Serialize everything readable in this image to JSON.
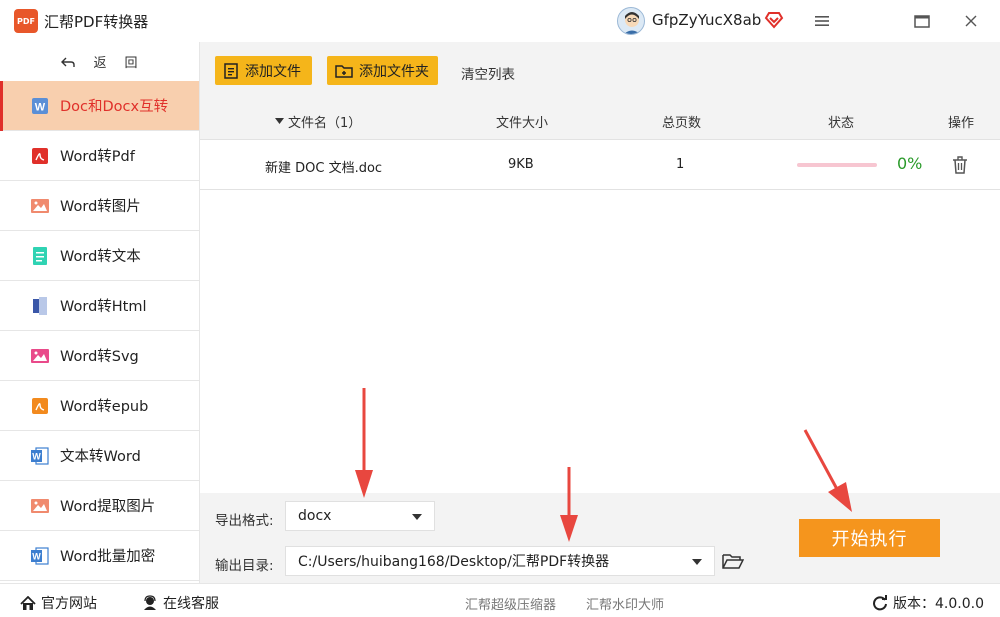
{
  "window": {
    "logo_text": "PDF",
    "title": "汇帮PDF转换器",
    "username": "GfpZyYucX8ab",
    "icons": {
      "vip": "vip-diamond-icon",
      "menu": "menu-icon",
      "maximize": "maximize-icon",
      "close": "close-icon"
    }
  },
  "sidebar": {
    "back_label": "返",
    "back_label2": "回",
    "items": [
      {
        "label": "Doc和Docx互转",
        "icon": "word-doc-icon",
        "active": true
      },
      {
        "label": "Word转Pdf",
        "icon": "pdf-icon"
      },
      {
        "label": "Word转图片",
        "icon": "image-icon"
      },
      {
        "label": "Word转文本",
        "icon": "text-file-icon"
      },
      {
        "label": "Word转Html",
        "icon": "html-icon"
      },
      {
        "label": "Word转Svg",
        "icon": "svg-image-icon"
      },
      {
        "label": "Word转epub",
        "icon": "epub-icon"
      },
      {
        "label": "文本转Word",
        "icon": "word-icon"
      },
      {
        "label": "Word提取图片",
        "icon": "extract-image-icon"
      },
      {
        "label": "Word批量加密",
        "icon": "word-lock-icon"
      }
    ]
  },
  "toolbar": {
    "add_file": "添加文件",
    "add_folder": "添加文件夹",
    "clear_list": "清空列表"
  },
  "table": {
    "headers": {
      "name": "文件名（1）",
      "size": "文件大小",
      "pages": "总页数",
      "status": "状态",
      "action": "操作"
    },
    "rows": [
      {
        "name": "新建 DOC 文档.doc",
        "size": "9KB",
        "pages": "1",
        "progress_pct": "0%",
        "progress": 0.0
      }
    ]
  },
  "settings": {
    "format_label": "导出格式:",
    "format_value": "docx",
    "dir_label": "输出目录:",
    "dir_value": "C:/Users/huibang168/Desktop/汇帮PDF转换器",
    "start_button": "开始执行"
  },
  "footer": {
    "website": "官方网站",
    "support": "在线客服",
    "link1": "汇帮超级压缩器",
    "link2": "汇帮水印大师",
    "version_label": "版本：4.0.0.0"
  },
  "colors": {
    "accent_orange": "#f5951d",
    "button_yellow": "#f5b51a",
    "active_bg": "#f8cfae",
    "active_text": "#e0302a",
    "progress_green": "#2a9a2a",
    "annotation_arrow": "#e8473f"
  }
}
